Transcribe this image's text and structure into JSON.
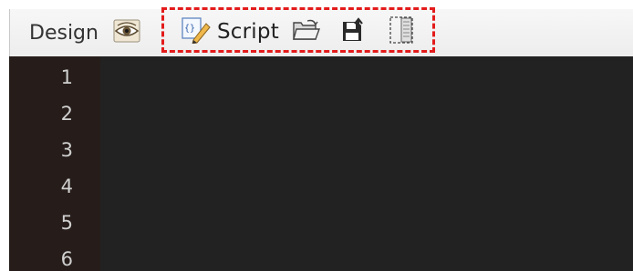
{
  "toolbar": {
    "design_label": "Design",
    "script_label": "Script"
  },
  "icons": {
    "preview": "eye-icon",
    "script": "script-edit-icon",
    "open": "open-folder-icon",
    "save": "save-icon",
    "panel": "panel-toggle-icon"
  },
  "editor": {
    "line_numbers": [
      "1",
      "2",
      "3",
      "4",
      "5",
      "6"
    ]
  },
  "colors": {
    "highlight": "#e31b1b",
    "editor_bg": "#222222",
    "gutter_bg": "#261d1a"
  }
}
